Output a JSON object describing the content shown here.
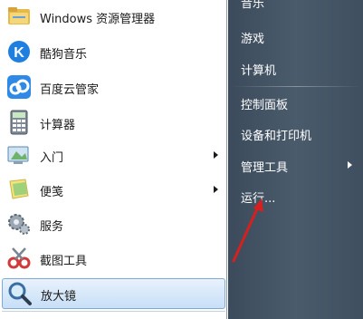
{
  "programs": [
    {
      "label": "Windows 资源管理器",
      "icon": "folder-icon",
      "has_submenu": false,
      "selected": false
    },
    {
      "label": "酷狗音乐",
      "icon": "kugou-icon",
      "has_submenu": false,
      "selected": false
    },
    {
      "label": "百度云管家",
      "icon": "baidu-cloud-icon",
      "has_submenu": false,
      "selected": false
    },
    {
      "label": "计算器",
      "icon": "calculator-icon",
      "has_submenu": false,
      "selected": false
    },
    {
      "label": "入门",
      "icon": "getting-started-icon",
      "has_submenu": true,
      "selected": false
    },
    {
      "label": "便笺",
      "icon": "sticky-notes-icon",
      "has_submenu": true,
      "selected": false
    },
    {
      "label": "服务",
      "icon": "services-icon",
      "has_submenu": false,
      "selected": false
    },
    {
      "label": "截图工具",
      "icon": "snipping-tool-icon",
      "has_submenu": false,
      "selected": false
    },
    {
      "label": "放大镜",
      "icon": "magnifier-icon",
      "has_submenu": false,
      "selected": true
    }
  ],
  "right_links": [
    {
      "label": "音乐",
      "has_submenu": false
    },
    {
      "label": "游戏",
      "has_submenu": false
    },
    {
      "label": "计算机",
      "has_submenu": false
    },
    {
      "label": "控制面板",
      "has_submenu": false
    },
    {
      "label": "设备和打印机",
      "has_submenu": false
    },
    {
      "label": "管理工具",
      "has_submenu": true
    },
    {
      "label": "运行...",
      "has_submenu": false
    }
  ],
  "colors": {
    "right_pane": "#4a5b6c",
    "annotation_arrow": "#d62020",
    "selection": "#c7dff7"
  }
}
